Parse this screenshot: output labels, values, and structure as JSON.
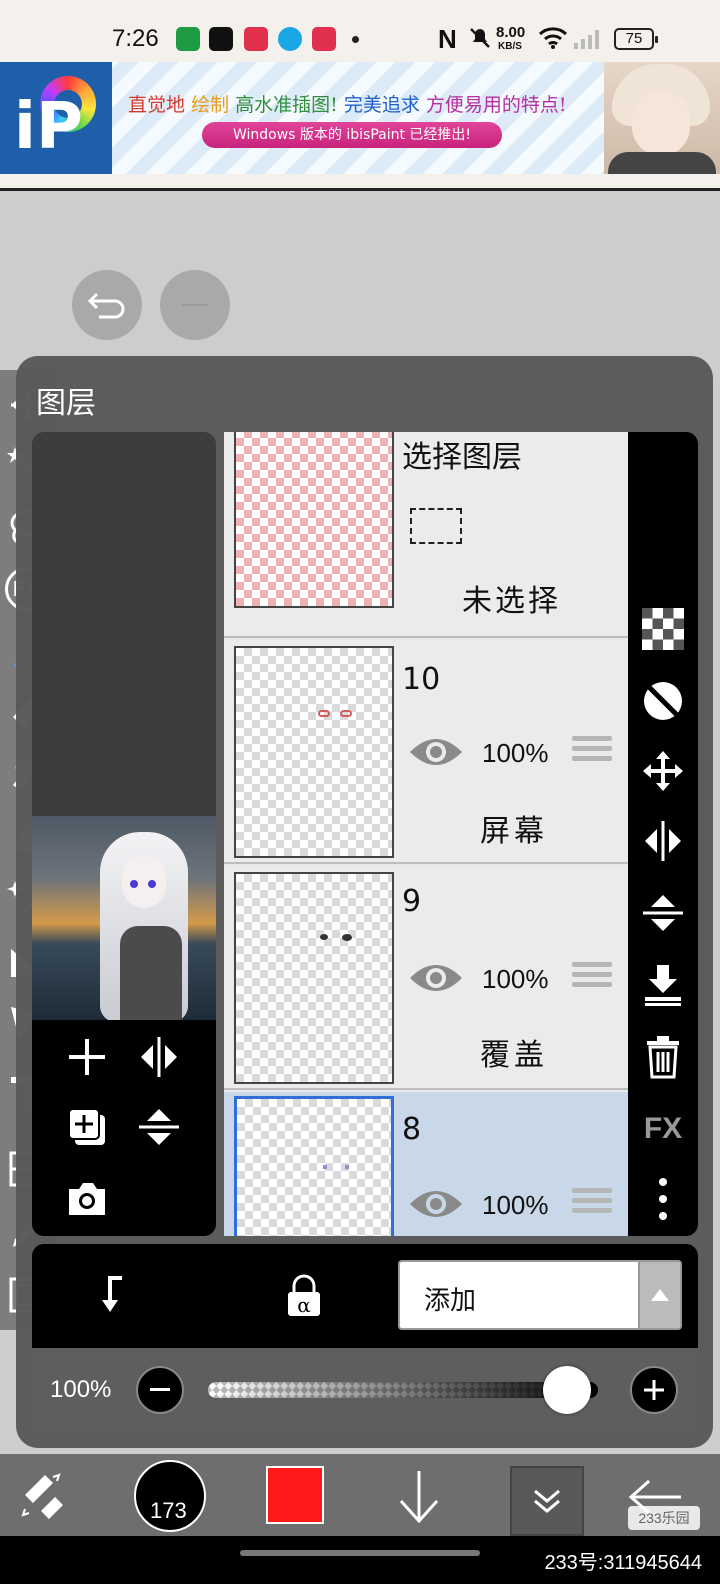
{
  "status_bar": {
    "time": "7:26",
    "speed_value": "8.00",
    "speed_unit": "KB/S",
    "battery": "75",
    "nfc_letter": "N"
  },
  "ad_banner": {
    "logo_letter": "iP",
    "headline_parts": [
      {
        "text": "直觉地",
        "color": "#d63a2e"
      },
      {
        "text": "绘制",
        "color": "#e89a1a"
      },
      {
        "text": "高水准插图!",
        "color": "#2f8f3a"
      },
      {
        "text": "完美追求",
        "color": "#1f5fcf"
      },
      {
        "text": "方便易用的特点!",
        "color": "#b52fa3"
      }
    ],
    "subline": "Windows 版本的 ibisPaint 已经推出!"
  },
  "panel": {
    "title": "图层",
    "selection_layer": {
      "title": "选择图层",
      "status": "未选择"
    },
    "layers": [
      {
        "name": "10",
        "opacity": "100%",
        "blend": "屏幕",
        "selected": false
      },
      {
        "name": "9",
        "opacity": "100%",
        "blend": "覆盖",
        "selected": false
      },
      {
        "name": "8",
        "opacity": "100%",
        "blend": "",
        "selected": true
      }
    ],
    "right_tools": [
      "checker-icon",
      "invert-icon",
      "move-icon",
      "flip-horizontal-icon",
      "flip-vertical-icon",
      "merge-down-icon",
      "trash-icon",
      "fx-label",
      "more-icon"
    ],
    "fx_label": "FX",
    "blend_mode_value": "添加",
    "opacity_label": "100%",
    "opacity_value": 0.92
  },
  "left_toolbar": {
    "fx_label": "FX"
  },
  "bottom_toolbar": {
    "brush_size": "173",
    "color": "#ff1a1a",
    "watermark_logo": "233乐园"
  },
  "watermark_id": "233号:311945644",
  "colors": {
    "accent_blue": "#2f6fd6",
    "panel_bg": "#5a5a5a",
    "selected_row": "#c9d8e8"
  }
}
